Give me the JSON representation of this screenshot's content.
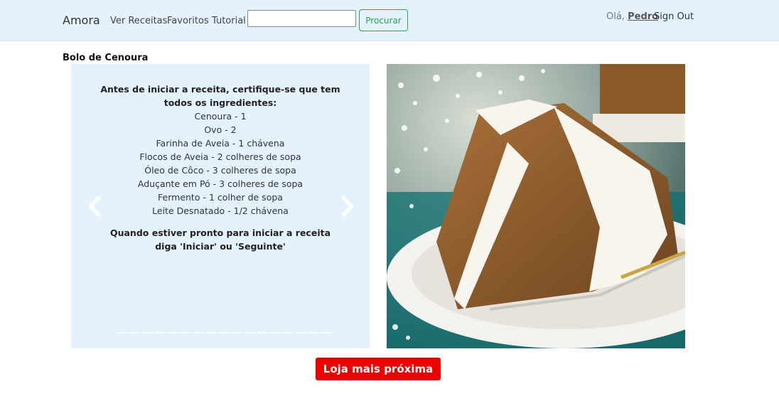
{
  "navbar": {
    "brand": "Amora",
    "links": [
      "Ver Receitas",
      "Favoritos",
      "Tutorial"
    ],
    "search_value": "",
    "search_button": "Procurar",
    "greeting": "Olá,",
    "username": "Pedro",
    "signout": "Sign Out",
    "background": "#e3f2fd",
    "accent_green": "#28a745"
  },
  "recipe": {
    "title": "Bolo de Cenoura",
    "intro": "Antes de iniciar a receita, certifique-se que tem todos os ingredientes:",
    "ingredients": [
      "Cenoura - 1",
      "Ovo - 2",
      "Farinha de Aveia - 1 chávena",
      "Flocos de Aveia - 2 colheres de sopa",
      "Óleo de Côco - 3 colheres de sopa",
      "Aduçante em Pó - 3 colheres de sopa",
      "Fermento - 1 colher de sopa",
      "Leite Desnatado - 1/2 chávena"
    ],
    "outro": "Quando estiver pronto para iniciar a receita diga 'Iniciar' ou 'Seguinte'",
    "indicator_count": 17,
    "prev_icon": "chevron-left-icon",
    "next_icon": "chevron-right-icon"
  },
  "store_button": "Loja mais próxima",
  "store_button_color": "#ee0000"
}
